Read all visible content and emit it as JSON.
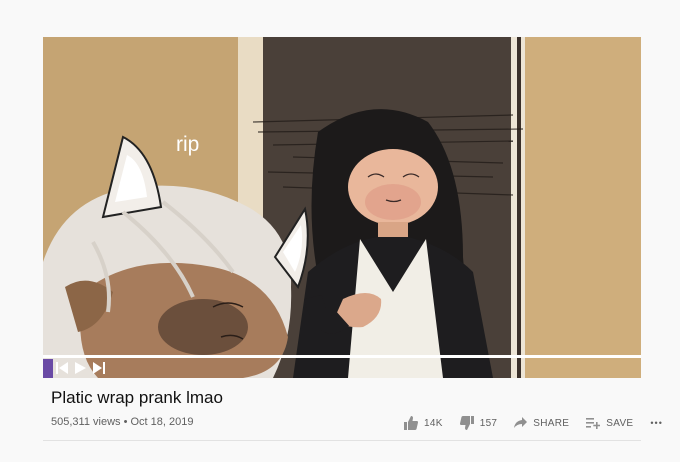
{
  "video": {
    "caption": "rip",
    "title": "Platic wrap prank lmao",
    "views": "505,311 views",
    "separator": "•",
    "date": "Oct 18, 2019",
    "progress_fraction": 1.0
  },
  "actions": {
    "like_count": "14K",
    "dislike_count": "157",
    "share_label": "SHARE",
    "save_label": "SAVE",
    "more_label": "•••"
  },
  "colors": {
    "accent_progress": "#ffffff",
    "text_primary": "#111111",
    "text_secondary": "#606060"
  }
}
